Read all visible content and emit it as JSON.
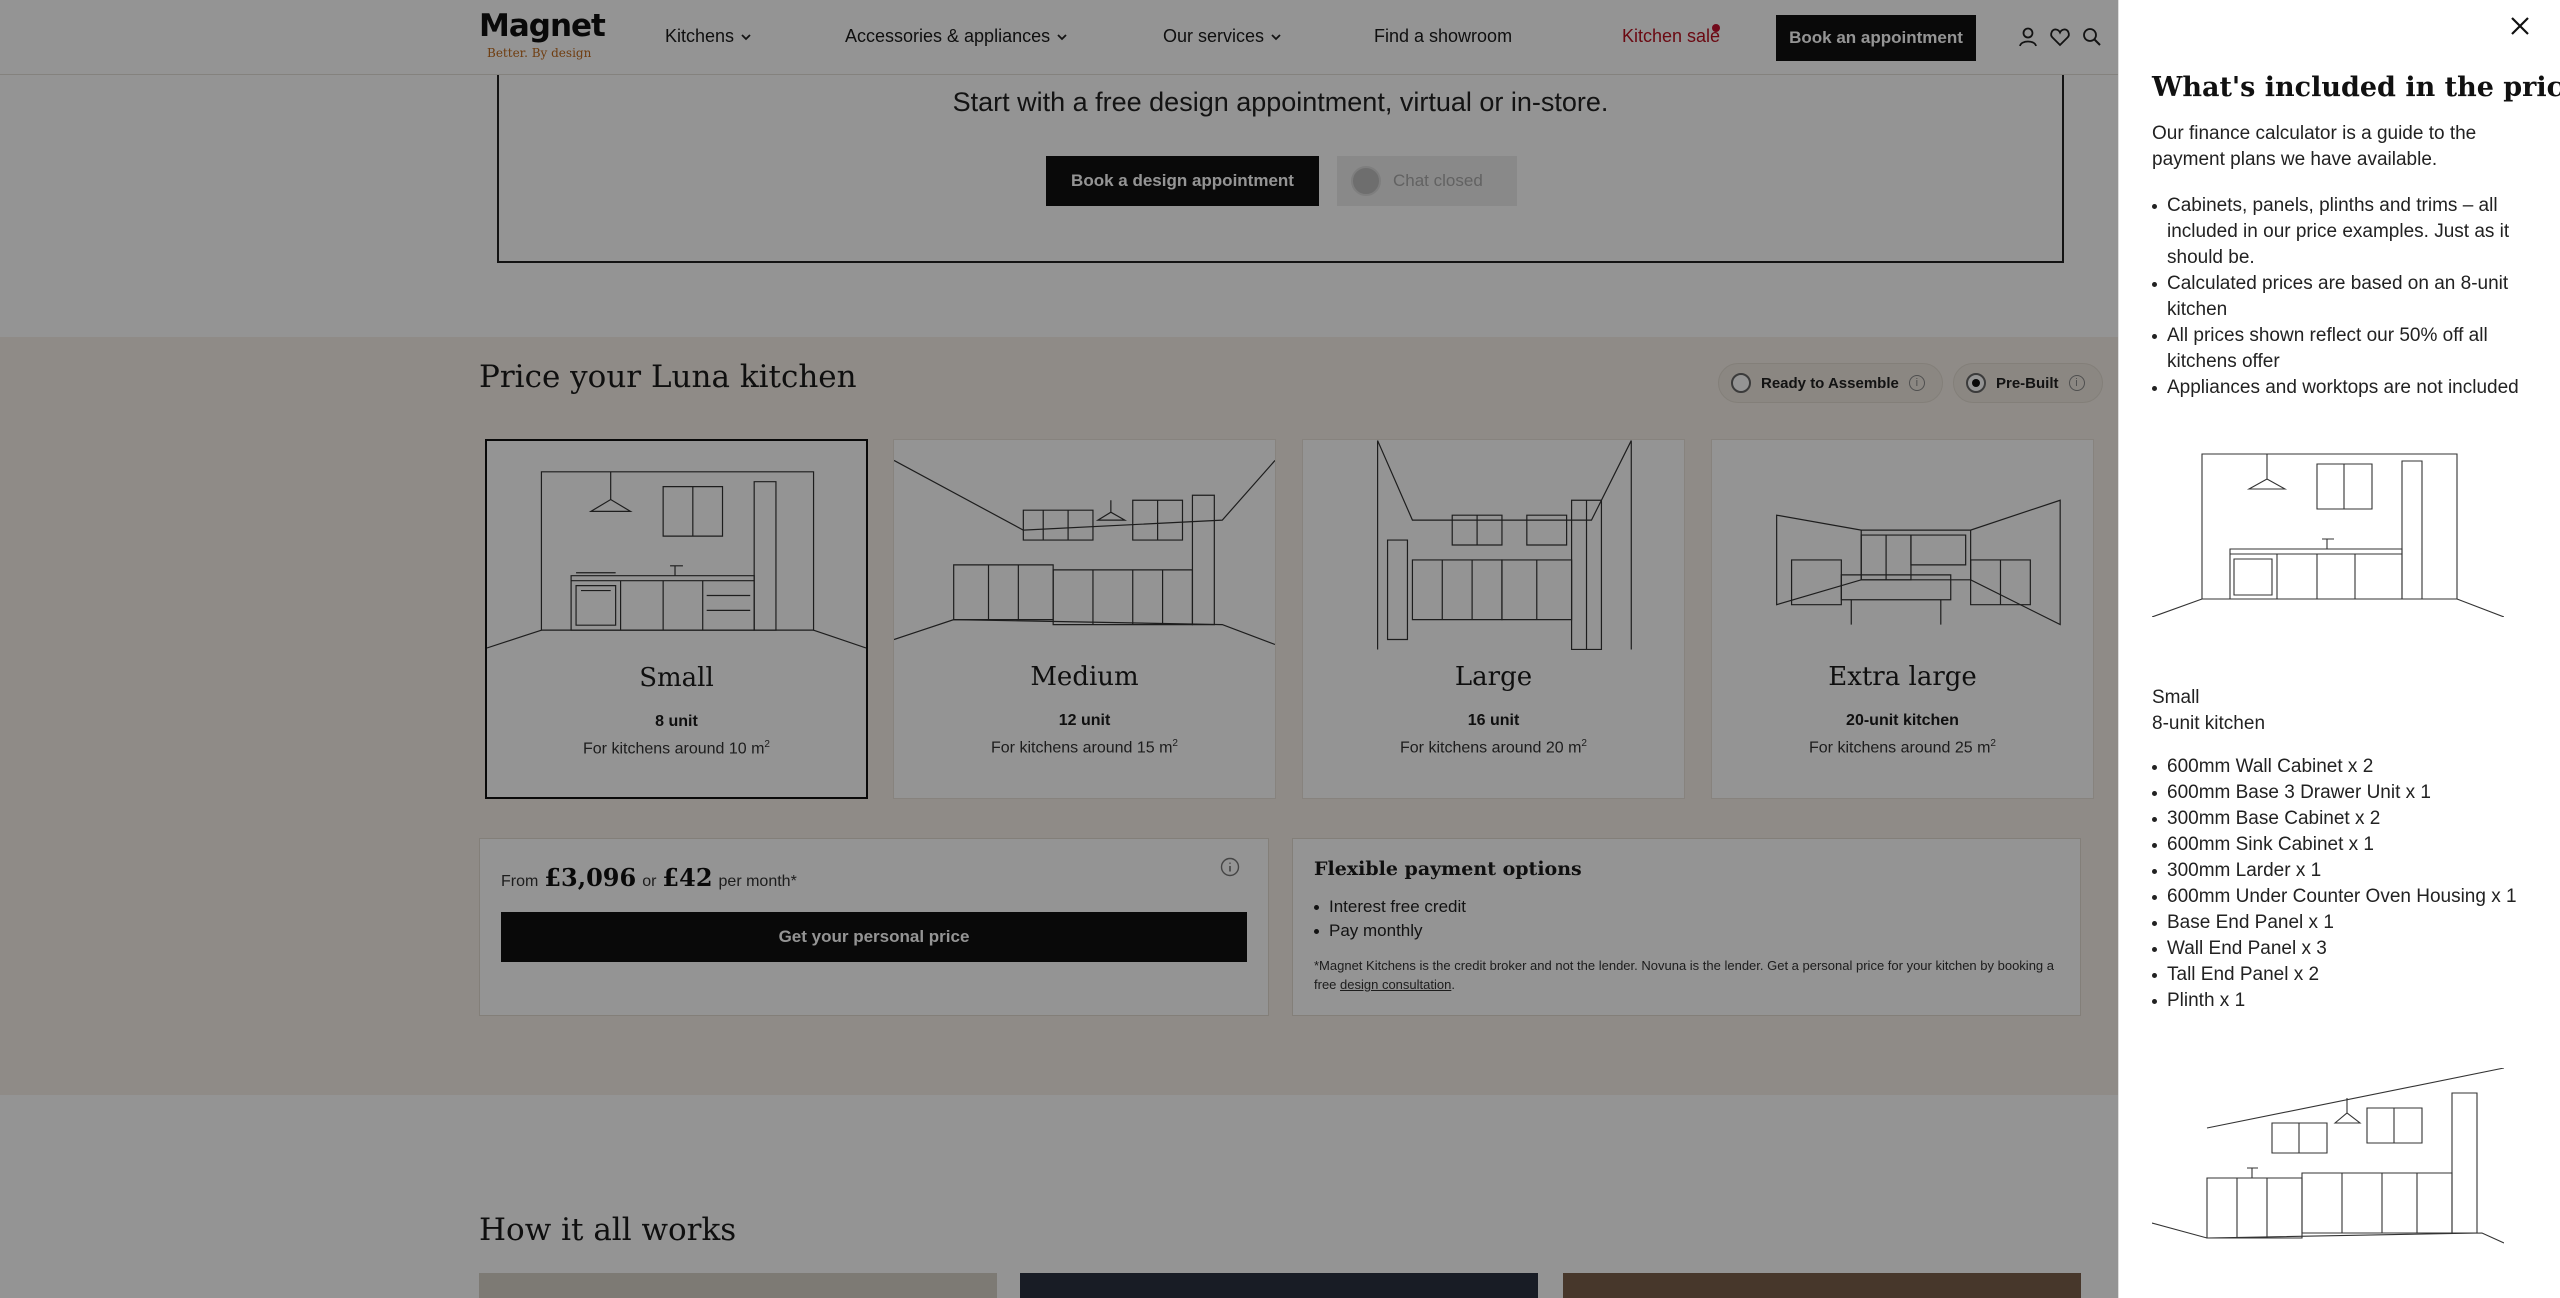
{
  "header": {
    "logo_word": "Magnet",
    "logo_tagline": "Better. By design",
    "nav": [
      {
        "label": "Kitchens"
      },
      {
        "label": "Accessories & appliances"
      },
      {
        "label": "Our services"
      },
      {
        "label": "Find a showroom"
      },
      {
        "label": "Kitchen sale"
      }
    ],
    "book_button": "Book an appointment",
    "icons": [
      "account-icon",
      "heart-icon",
      "search-icon"
    ]
  },
  "cta": {
    "text": "Start with a free design appointment, virtual or in-store.",
    "book_design": "Book a design appointment",
    "chat": "Chat closed"
  },
  "pricing": {
    "title": "Price your Luna kitchen",
    "options": [
      {
        "label": "Ready to Assemble",
        "selected": false
      },
      {
        "label": "Pre-Built",
        "selected": true
      }
    ],
    "sizes": [
      {
        "name": "Small",
        "units": "8 unit",
        "size_text": "For kitchens around 10 m",
        "selected": true
      },
      {
        "name": "Medium",
        "units": "12 unit",
        "size_text": "For kitchens around 15 m",
        "selected": false
      },
      {
        "name": "Large",
        "units": "16 unit",
        "size_text": "For kitchens around 20 m",
        "selected": false
      },
      {
        "name": "Extra large",
        "units": "20-unit kitchen",
        "size_text": "For kitchens around 25 m",
        "selected": false
      }
    ],
    "sup": "2",
    "from_label": "From",
    "from_price": "£3,096",
    "or_label": "or",
    "monthly_price": "£42",
    "per_month": "per month*",
    "personal_price_button": "Get your personal price",
    "flex_title": "Flexible payment options",
    "flex_items": [
      "Interest free credit",
      "Pay monthly"
    ],
    "flex_note_1": "*Magnet Kitchens is the credit broker and not the lender. Novuna is the lender. Get a personal price for your kitchen by booking a free",
    "flex_note_link": "design consultation",
    "flex_note_end": "."
  },
  "how": {
    "title": "How it all works"
  },
  "drawer": {
    "title": "What's included in the price?",
    "intro": "Our finance calculator is a guide to the payment plans we have available.",
    "bullets": [
      "Cabinets, panels, plinths and trims – all included in our price examples. Just as it should be.",
      "Calculated prices are based on an 8-unit kitchen",
      "All prices shown reflect our 50% off all kitchens offer",
      "Appliances and worktops are not included"
    ],
    "size_name": "Small",
    "size_units": "8-unit kitchen",
    "items": [
      "600mm Wall Cabinet x 2",
      "600mm Base 3 Drawer Unit x 1",
      "300mm Base Cabinet x 2",
      "600mm Sink Cabinet x 1",
      "300mm Larder x 1",
      "600mm Under Counter Oven Housing x 1",
      "Base End Panel x 1",
      "Wall End Panel x 3",
      "Tall End Panel x 2",
      "Plinth x 1"
    ]
  },
  "colors": {
    "accent_black": "#111111",
    "sale_red": "#b8101f",
    "section_bg": "#f6f0e8",
    "logo_tag": "#c06a1c"
  }
}
